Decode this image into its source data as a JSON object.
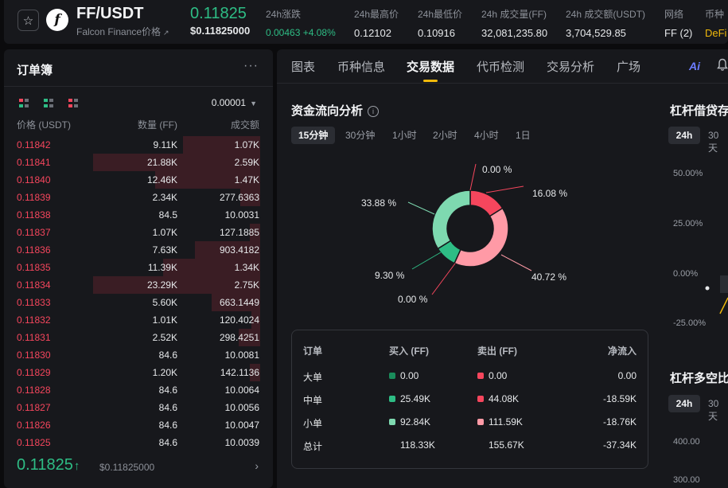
{
  "header": {
    "pair": "FF/USDT",
    "subtitle": "Falcon Finance价格",
    "subtitle_icon": "external-link-icon",
    "price": "0.11825",
    "price_usd": "$0.11825000",
    "stats": [
      {
        "label": "24h涨跌",
        "value": "0.00463 +4.08%",
        "color": "green"
      },
      {
        "label": "24h最高价",
        "value": "0.12102",
        "color": ""
      },
      {
        "label": "24h最低价",
        "value": "0.10916",
        "color": ""
      },
      {
        "label": "24h 成交量(FF)",
        "value": "32,081,235.80",
        "color": ""
      },
      {
        "label": "24h 成交额(USDT)",
        "value": "3,704,529.85",
        "color": ""
      },
      {
        "label": "网络",
        "value": "FF (2)",
        "color": ""
      },
      {
        "label": "币种",
        "value": "DeFi",
        "color": "gold"
      }
    ]
  },
  "orderbook": {
    "title": "订单簿",
    "precision": "0.00001",
    "col_price": "价格 (USDT)",
    "col_qty": "数量 (FF)",
    "col_total": "成交额",
    "rows": [
      {
        "price": "0.11842",
        "qty": "9.11K",
        "total": "1.07K",
        "depth": 0.46
      },
      {
        "price": "0.11841",
        "qty": "21.88K",
        "total": "2.59K",
        "depth": 1.0
      },
      {
        "price": "0.11840",
        "qty": "12.46K",
        "total": "1.47K",
        "depth": 0.63
      },
      {
        "price": "0.11839",
        "qty": "2.34K",
        "total": "277.6363",
        "depth": 0.12
      },
      {
        "price": "0.11838",
        "qty": "84.5",
        "total": "10.0031",
        "depth": 0.0
      },
      {
        "price": "0.11837",
        "qty": "1.07K",
        "total": "127.1885",
        "depth": 0.06
      },
      {
        "price": "0.11836",
        "qty": "7.63K",
        "total": "903.4182",
        "depth": 0.39
      },
      {
        "price": "0.11835",
        "qty": "11.39K",
        "total": "1.34K",
        "depth": 0.58
      },
      {
        "price": "0.11834",
        "qty": "23.29K",
        "total": "2.75K",
        "depth": 1.0
      },
      {
        "price": "0.11833",
        "qty": "5.60K",
        "total": "663.1449",
        "depth": 0.29
      },
      {
        "price": "0.11832",
        "qty": "1.01K",
        "total": "120.4024",
        "depth": 0.05
      },
      {
        "price": "0.11831",
        "qty": "2.52K",
        "total": "298.4251",
        "depth": 0.13
      },
      {
        "price": "0.11830",
        "qty": "84.6",
        "total": "10.0081",
        "depth": 0.0
      },
      {
        "price": "0.11829",
        "qty": "1.20K",
        "total": "142.1136",
        "depth": 0.06
      },
      {
        "price": "0.11828",
        "qty": "84.6",
        "total": "10.0064",
        "depth": 0.0
      },
      {
        "price": "0.11827",
        "qty": "84.6",
        "total": "10.0056",
        "depth": 0.0
      },
      {
        "price": "0.11826",
        "qty": "84.6",
        "total": "10.0047",
        "depth": 0.0
      },
      {
        "price": "0.11825",
        "qty": "84.6",
        "total": "10.0039",
        "depth": 0.0
      }
    ],
    "last_price": "0.11825",
    "last_arrow": "↑",
    "last_usd": "$0.11825000"
  },
  "tabs": [
    "图表",
    "币种信息",
    "交易数据",
    "代币检测",
    "交易分析",
    "广场"
  ],
  "active_tab": "交易数据",
  "fund_flow": {
    "title": "资金流向分析",
    "timeframes": [
      "15分钟",
      "30分钟",
      "1小时",
      "2小时",
      "4小时",
      "1日"
    ],
    "active_timeframe": "15分钟",
    "labels": {
      "buy_large": "0.00 %",
      "sell_large": "0.00 %",
      "sell_medium": "16.08 %",
      "sell_small": "40.72 %",
      "buy_small": "33.88 %",
      "buy_medium": "9.30 %"
    },
    "colors": {
      "buy_large": "#1a8c5b",
      "buy_medium": "#2ebd85",
      "buy_small": "#7ed9b0",
      "sell_large": "#c5283d",
      "sell_medium": "#f6465d",
      "sell_small": "#ff9aa6"
    },
    "table": {
      "headers": [
        "订单",
        "买入 (FF)",
        "卖出 (FF)",
        "净流入"
      ],
      "rows": [
        {
          "name": "大单",
          "buy": "0.00",
          "sell": "0.00",
          "net": "0.00"
        },
        {
          "name": "中单",
          "buy": "25.49K",
          "sell": "44.08K",
          "net": "-18.59K"
        },
        {
          "name": "小单",
          "buy": "92.84K",
          "sell": "111.59K",
          "net": "-18.76K"
        },
        {
          "name": "总计",
          "buy": "118.33K",
          "sell": "155.67K",
          "net": "-37.34K"
        }
      ]
    }
  },
  "chart_data": {
    "type": "pie",
    "categories": [
      "大单买入",
      "中单买入",
      "小单买入",
      "大单卖出",
      "中单卖出",
      "小单卖出"
    ],
    "values": [
      0.0,
      9.3,
      33.88,
      0.0,
      16.08,
      40.72
    ]
  },
  "leverage": {
    "title1": "杠杆借贷存",
    "pill_24h": "24h",
    "pill_30d": "30天",
    "axis": [
      "50.00%",
      "25.00%",
      "0.00%",
      "-25.00%"
    ],
    "title2": "杠杆多空比",
    "axis2": [
      "400.00",
      "300.00"
    ]
  }
}
